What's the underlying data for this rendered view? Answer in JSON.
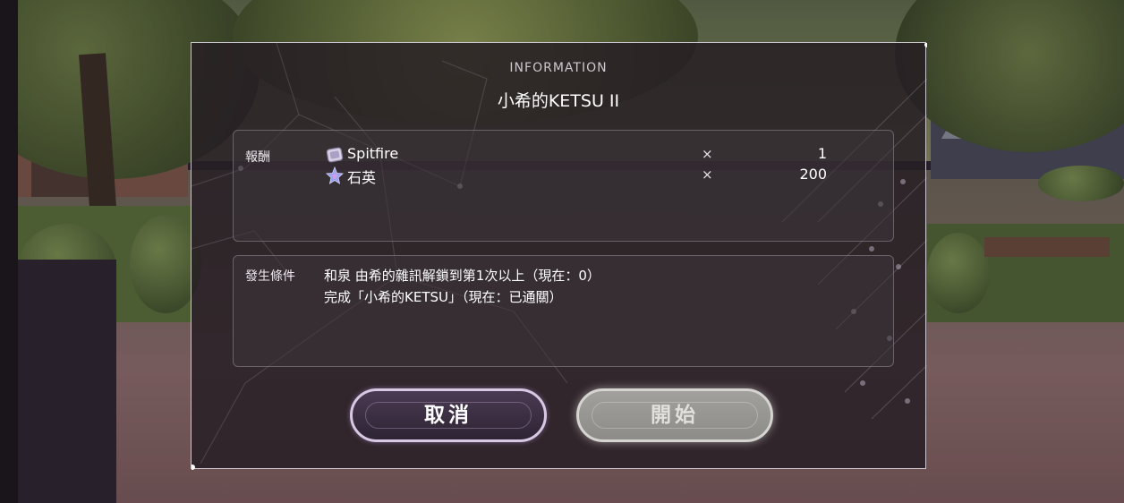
{
  "dialog": {
    "header": "INFORMATION",
    "title": "小希的KETSU II"
  },
  "rewards": {
    "label": "報酬",
    "items": [
      {
        "icon": "spitfire-item-icon",
        "name": "Spitfire",
        "x": "×",
        "qty": "1"
      },
      {
        "icon": "quartz-crystal-icon",
        "name": "石英",
        "x": "×",
        "qty": "200"
      }
    ]
  },
  "conditions": {
    "label": "發生條件",
    "lines": [
      "和泉 由希的雜訊解鎖到第1次以上（現在：0）",
      "完成「小希的KETSU」（現在：已通關）"
    ]
  },
  "buttons": {
    "cancel": "取消",
    "start": "開始"
  },
  "colors": {
    "dialog_bg": "#261e24",
    "start_disabled": "#9a9894",
    "cancel_border": "#d8c8e4"
  }
}
